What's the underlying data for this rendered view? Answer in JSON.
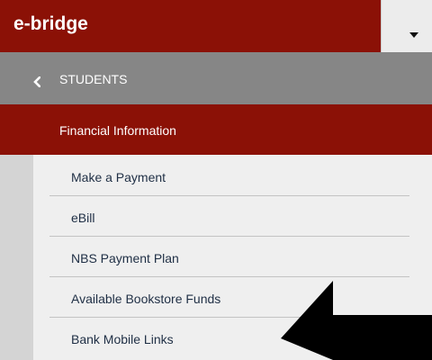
{
  "header": {
    "brand": "e-bridge",
    "toggle_icon": "caret-down-icon"
  },
  "nav": {
    "back_icon": "chevron-left-icon",
    "section_title": "STUDENTS",
    "active_item": "Financial Information",
    "submenu": [
      {
        "label": "Make a Payment"
      },
      {
        "label": "eBill"
      },
      {
        "label": "NBS Payment Plan"
      },
      {
        "label": "Available Bookstore Funds"
      },
      {
        "label": "Bank Mobile Links"
      }
    ]
  },
  "annotation": {
    "icon": "arrow-left-icon",
    "color": "#000000"
  },
  "colors": {
    "brand": "#8b1106",
    "section": "#868686",
    "submenu_bg": "#efefef",
    "text": "#1f2f45"
  }
}
